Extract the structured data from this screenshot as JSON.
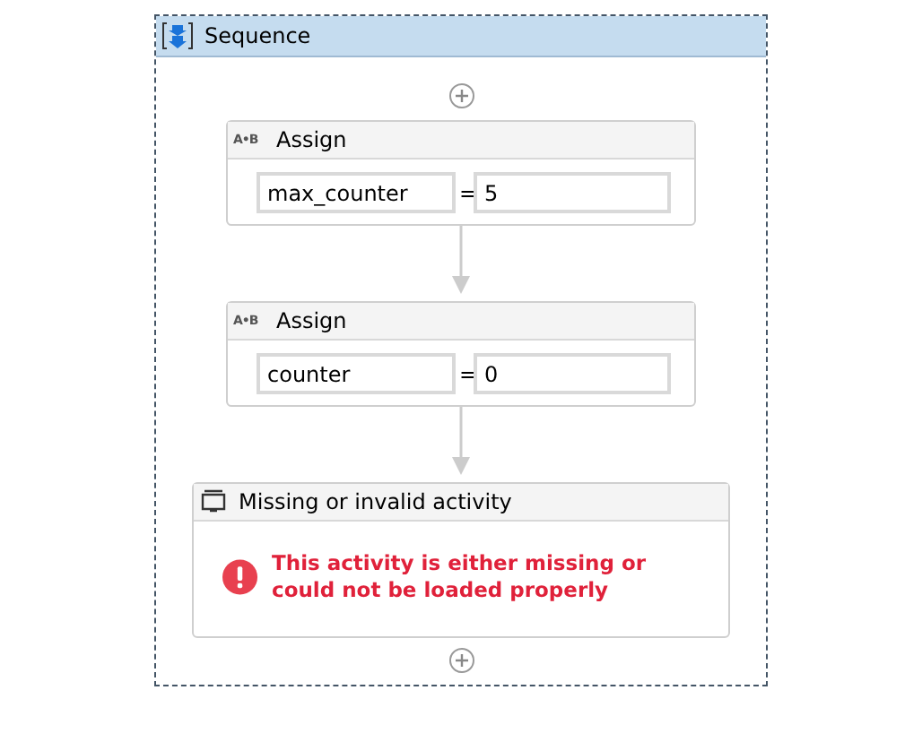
{
  "sequence": {
    "title": "Sequence",
    "activities": [
      {
        "kind": "assign",
        "icon_text": "A•B",
        "title": "Assign",
        "to": "max_counter",
        "operator": "=",
        "value": "5"
      },
      {
        "kind": "assign",
        "icon_text": "A•B",
        "title": "Assign",
        "to": "counter",
        "operator": "=",
        "value": "0"
      },
      {
        "kind": "missing",
        "title": "Missing or invalid activity",
        "message": "This activity is either missing or could not be loaded properly"
      }
    ]
  }
}
